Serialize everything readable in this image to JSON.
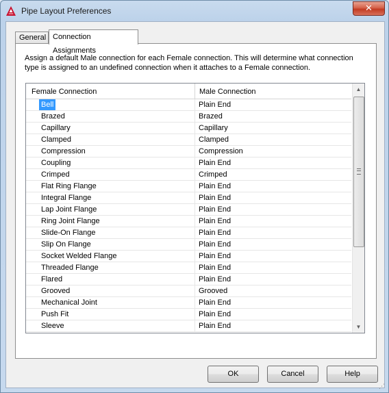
{
  "window": {
    "title": "Pipe Layout Preferences",
    "close_label": "✕"
  },
  "tabs": [
    {
      "label": "General"
    },
    {
      "label": "Connection Assignments"
    }
  ],
  "description": "Assign a default Male connection for each Female connection. This will determine what connection type is assigned to an undefined connection when it attaches to a Female connection.",
  "table": {
    "columns": [
      "Female Connection",
      "Male Connection"
    ],
    "rows": [
      {
        "female": "Bell",
        "male": "Plain End"
      },
      {
        "female": "Brazed",
        "male": "Brazed"
      },
      {
        "female": "Capillary",
        "male": "Capillary"
      },
      {
        "female": "Clamped",
        "male": "Clamped"
      },
      {
        "female": "Compression",
        "male": "Compression"
      },
      {
        "female": "Coupling",
        "male": "Plain End"
      },
      {
        "female": "Crimped",
        "male": "Crimped"
      },
      {
        "female": "Flat Ring Flange",
        "male": "Plain End"
      },
      {
        "female": "Integral Flange",
        "male": "Plain End"
      },
      {
        "female": "Lap Joint Flange",
        "male": "Plain End"
      },
      {
        "female": "Ring Joint Flange",
        "male": "Plain End"
      },
      {
        "female": "Slide-On Flange",
        "male": "Plain End"
      },
      {
        "female": "Slip On Flange",
        "male": "Plain End"
      },
      {
        "female": "Socket Welded Flange",
        "male": "Plain End"
      },
      {
        "female": "Threaded Flange",
        "male": "Plain End"
      },
      {
        "female": "Flared",
        "male": "Plain End"
      },
      {
        "female": "Grooved",
        "male": "Grooved"
      },
      {
        "female": "Mechanical Joint",
        "male": "Plain End"
      },
      {
        "female": "Push Fit",
        "male": "Plain End"
      },
      {
        "female": "Sleeve",
        "male": "Plain End"
      }
    ],
    "selected_row": 0
  },
  "buttons": {
    "ok": "OK",
    "cancel": "Cancel",
    "help": "Help"
  },
  "icons": {
    "app": "autocad-logo-icon",
    "scroll_up": "▲",
    "scroll_down": "▼"
  }
}
